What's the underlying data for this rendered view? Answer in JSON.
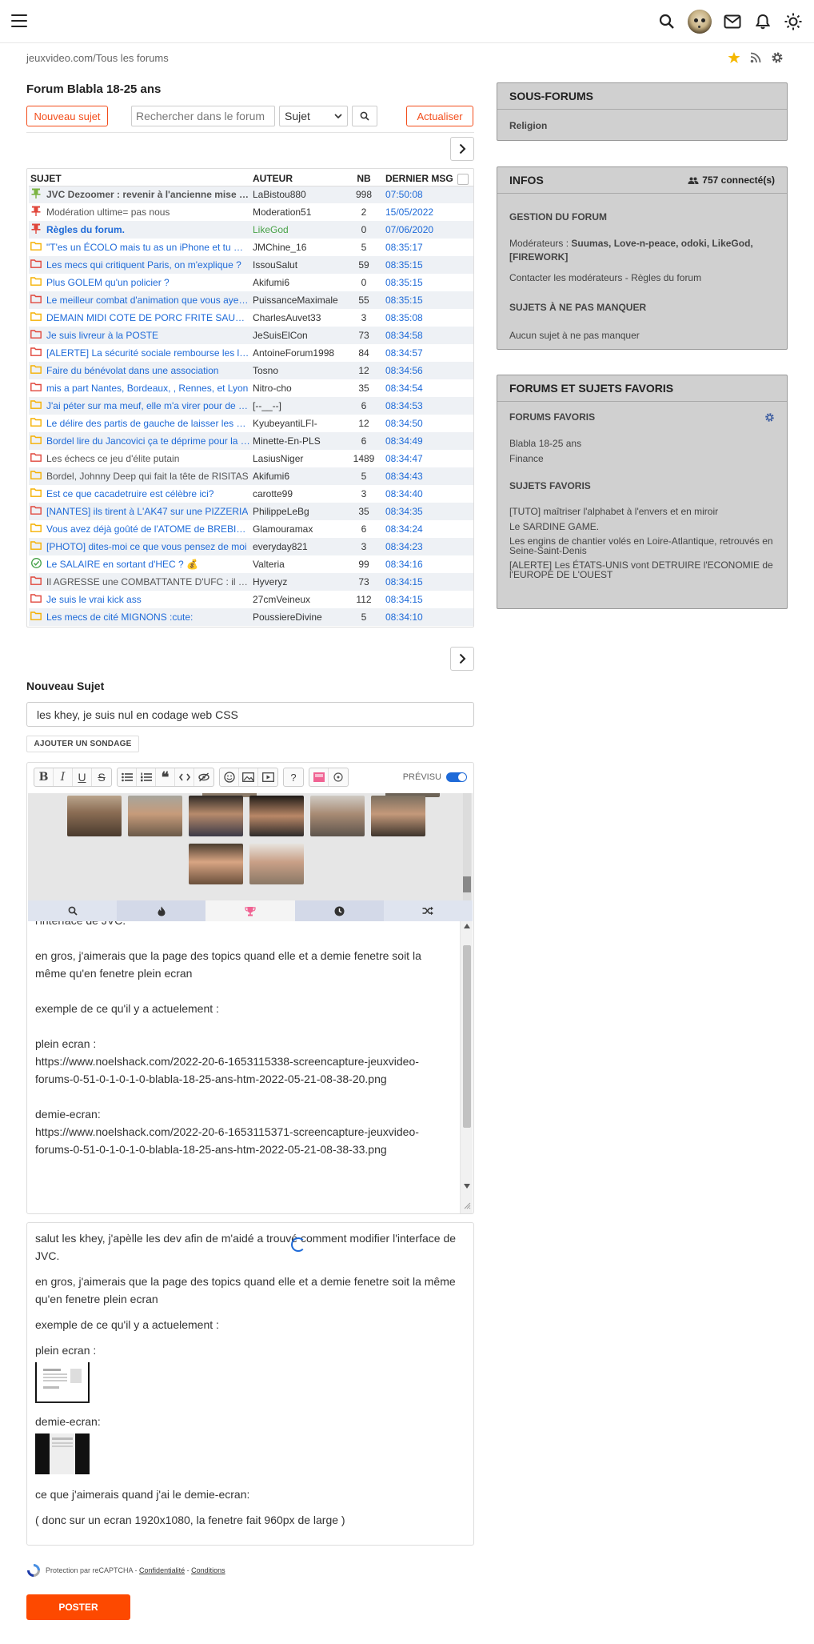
{
  "breadcrumb": {
    "site": "jeuxvideo.com",
    "separator": "/",
    "section": "Tous les forums"
  },
  "forum": {
    "title": "Forum Blabla 18-25 ans",
    "new_topic_label": "Nouveau sujet",
    "search_placeholder": "Rechercher dans le forum",
    "search_scope": "Sujet",
    "refresh_label": "Actualiser"
  },
  "table": {
    "headers": {
      "subject": "SUJET",
      "author": "AUTEUR",
      "count": "NB",
      "last": "DERNIER MSG"
    },
    "rows": [
      {
        "icon": "pin-green",
        "style": "grey-bold",
        "subject": "JVC Dezoomer : revenir à l'ancienne mise en page",
        "author": "LaBistou880",
        "author_style": "",
        "nb": "998",
        "last": "07:50:08"
      },
      {
        "icon": "pin-red",
        "style": "grey",
        "subject": "Modération ultime= pas nous",
        "author": "Moderation51",
        "author_style": "",
        "nb": "2",
        "last": "15/05/2022"
      },
      {
        "icon": "pin-red",
        "style": "blue-bold",
        "subject": "Règles du forum.",
        "author": "LikeGod",
        "author_style": "green",
        "nb": "0",
        "last": "07/06/2020"
      },
      {
        "icon": "folder-yellow",
        "style": "blue",
        "subject": "\"T'es un ÉCOLO mais tu as un iPhone et tu manges de la viande\"",
        "author": "JMChine_16",
        "author_style": "",
        "nb": "5",
        "last": "08:35:17"
      },
      {
        "icon": "folder-red",
        "style": "blue",
        "subject": "Les mecs qui critiquent Paris, on m'explique ?",
        "author": "IssouSalut",
        "author_style": "",
        "nb": "59",
        "last": "08:35:15"
      },
      {
        "icon": "folder-yellow",
        "style": "blue",
        "subject": "Plus GOLEM qu'un policier ?",
        "author": "Akifumi6",
        "author_style": "",
        "nb": "0",
        "last": "08:35:15"
      },
      {
        "icon": "folder-red",
        "style": "blue",
        "subject": "Le meilleur combat d'animation que vous ayez vu",
        "author": "PuissanceMaximale",
        "author_style": "",
        "nb": "55",
        "last": "08:35:15"
      },
      {
        "icon": "folder-yellow",
        "style": "blue",
        "subject": "DEMAIN MIDI COTE DE PORC FRITE SAUCE POIVRE",
        "author": "CharlesAuvet33",
        "author_style": "",
        "nb": "3",
        "last": "08:35:08"
      },
      {
        "icon": "folder-red",
        "style": "blue",
        "subject": "Je suis livreur à la POSTE",
        "author": "JeSuisElCon",
        "author_style": "",
        "nb": "73",
        "last": "08:34:58"
      },
      {
        "icon": "folder-red",
        "style": "blue",
        "subject": "[ALERTE] La sécurité sociale rembourse les lunettes",
        "author": "AntoineForum1998",
        "author_style": "",
        "nb": "84",
        "last": "08:34:57"
      },
      {
        "icon": "folder-yellow",
        "style": "blue",
        "subject": "Faire du bénévolat dans une association",
        "author": "Tosno",
        "author_style": "",
        "nb": "12",
        "last": "08:34:56"
      },
      {
        "icon": "folder-red",
        "style": "blue",
        "subject": "mis a part Nantes, Bordeaux, , Rennes, et Lyon",
        "author": "Nitro-cho",
        "author_style": "",
        "nb": "35",
        "last": "08:34:54"
      },
      {
        "icon": "folder-yellow",
        "style": "blue",
        "subject": "J'ai péter sur ma meuf, elle m'a virer pour de bon",
        "author": "[--__--]",
        "author_style": "",
        "nb": "6",
        "last": "08:34:53"
      },
      {
        "icon": "folder-yellow",
        "style": "blue",
        "subject": "Le délire des partis de gauche de laisser les gens",
        "author": "KyubeyantiLFI-",
        "author_style": "",
        "nb": "12",
        "last": "08:34:50"
      },
      {
        "icon": "folder-yellow",
        "style": "blue",
        "subject": "Bordel lire du Jancovici ça te déprime pour la vie",
        "author": "Minette-En-PLS",
        "author_style": "",
        "nb": "6",
        "last": "08:34:49"
      },
      {
        "icon": "folder-red",
        "style": "grey",
        "subject": "Les échecs ce jeu d'élite putain",
        "author": "LasiusNiger",
        "author_style": "",
        "nb": "1489",
        "last": "08:34:47"
      },
      {
        "icon": "folder-yellow",
        "style": "grey",
        "subject": "Bordel, Johnny Deep qui fait la tête de RISITAS",
        "author": "Akifumi6",
        "author_style": "",
        "nb": "5",
        "last": "08:34:43"
      },
      {
        "icon": "folder-yellow",
        "style": "blue",
        "subject": "Est ce que cacadetruire est célèbre ici?",
        "author": "carotte99",
        "author_style": "",
        "nb": "3",
        "last": "08:34:40"
      },
      {
        "icon": "folder-red",
        "style": "blue",
        "subject": "[NANTES] ils tirent à L'AK47 sur une PIZZERIA",
        "author": "PhilippeLeBg",
        "author_style": "",
        "nb": "35",
        "last": "08:34:35"
      },
      {
        "icon": "folder-yellow",
        "style": "blue",
        "subject": "Vous avez déjà goûté de l'ATOME de BREBIS ?",
        "author": "Glamouramax",
        "author_style": "",
        "nb": "6",
        "last": "08:34:24"
      },
      {
        "icon": "folder-yellow",
        "style": "blue",
        "subject": "[PHOTO] dites-moi ce que vous pensez de moi",
        "author": "everyday821",
        "author_style": "",
        "nb": "3",
        "last": "08:34:23"
      },
      {
        "icon": "check-green",
        "style": "blue",
        "subject": "Le SALAIRE en sortant d'HEC ? 💰",
        "author": "Valteria",
        "author_style": "",
        "nb": "99",
        "last": "08:34:16"
      },
      {
        "icon": "folder-red",
        "style": "grey",
        "subject": "Il AGRESSE une COMBATTANTE D'UFC : il se fait démonter",
        "author": "Hyveryz",
        "author_style": "",
        "nb": "73",
        "last": "08:34:15"
      },
      {
        "icon": "folder-red",
        "style": "blue",
        "subject": "Je suis le vrai kick ass",
        "author": "27cmVeineux",
        "author_style": "",
        "nb": "112",
        "last": "08:34:15"
      },
      {
        "icon": "folder-yellow",
        "style": "blue",
        "subject": "Les mecs de cité MIGNONS :cute:",
        "author": "PoussiereDivine",
        "author_style": "",
        "nb": "5",
        "last": "08:34:10"
      }
    ]
  },
  "new_topic": {
    "heading": "Nouveau Sujet",
    "title_value": "les khey, je suis nul en codage web CSS",
    "poll_label": "AJOUTER UN SONDAGE",
    "preview_label": "PRÉVISU",
    "body_lines": [
      "l'interface de JVC.",
      "en gros, j'aimerais que la page des topics quand elle et a demie fenetre soit la même qu'en fenetre plein ecran",
      "exemple de ce qu'il y a actuelement :",
      "plein ecran :",
      " https://www.noelshack.com/2022-20-6-1653115338-screencapture-jeuxvideo-forums-0-51-0-1-0-1-0-blabla-18-25-ans-htm-2022-05-21-08-38-20.png",
      "demie-ecran:",
      " https://www.noelshack.com/2022-20-6-1653115371-screencapture-jeuxvideo-forums-0-51-0-1-0-1-0-blabla-18-25-ans-htm-2022-05-21-08-38-33.png"
    ],
    "preview": {
      "p1": "salut les khey, j'apèlle les dev afin de m'aidé a trouvé comment modifier l'interface de JVC.",
      "p2": "en gros, j'aimerais que la page des topics quand elle et a demie fenetre soit la même qu'en fenetre plein ecran",
      "p3": "exemple de ce qu'il y a actuelement :",
      "p4": "plein ecran :",
      "p5": "demie-ecran:",
      "p6": "ce que j'aimerais quand j'ai le demie-ecran:",
      "p7": "( donc sur un ecran 1920x1080, la fenetre fait 960px de large )"
    },
    "recaptcha": {
      "text": "Protection par reCAPTCHA - ",
      "privacy": "Confidentialité",
      "sep": " - ",
      "terms": "Conditions"
    },
    "submit_label": "POSTER"
  },
  "sidebar": {
    "subforums": {
      "title": "SOUS-FORUMS",
      "items": [
        "Religion"
      ]
    },
    "infos": {
      "title": "INFOS",
      "connected": "757 connecté(s)",
      "manage_title": "GESTION DU FORUM",
      "mods_label": "Modérateurs : ",
      "mods_names": "Suumas, Love-n-peace, odoki, LikeGod, [FIREWORK]",
      "contact": "Contacter les modérateurs - Règles du forum",
      "must_title": "SUJETS À NE PAS MANQUER",
      "must_text": "Aucun sujet à ne pas manquer"
    },
    "favorites": {
      "title": "FORUMS ET SUJETS FAVORIS",
      "forums_title": "FORUMS FAVORIS",
      "forums": [
        "Blabla 18-25 ans",
        "Finance"
      ],
      "topics_title": "SUJETS FAVORIS",
      "topics": [
        "[TUTO] maîtriser l'alphabet à l'envers et en miroir",
        "Le SARDINE GAME.",
        "Les engins de chantier volés en Loire-Atlantique, retrouvés en Seine-Saint-Denis",
        "[ALERTE] Les ÉTATS-UNIS vont DETRUIRE l'ECONOMIE de l'EUROPE DE L'OUEST"
      ]
    }
  },
  "colors": {
    "accent": "#f34d1b",
    "link": "#1e6ad8",
    "submit": "#fd4900",
    "sidebar_bg": "#d0d0d0"
  }
}
